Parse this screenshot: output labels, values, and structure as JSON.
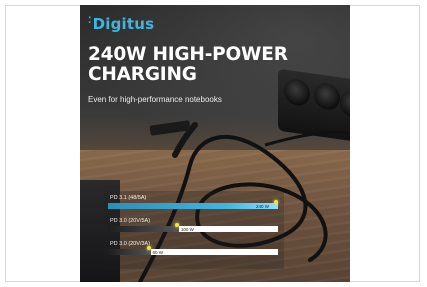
{
  "brand": {
    "name": "Digitus"
  },
  "headline": {
    "line1": "240W HIGH-POWER",
    "line2": "CHARGING"
  },
  "subline": "Even for high-performance notebooks",
  "chart_data": {
    "type": "bar",
    "orientation": "horizontal",
    "categories": [
      "PD 3.1 (48/5A)",
      "PD 3.0 (20V/5A)",
      "PD 3.0 (20V/3A)"
    ],
    "values": [
      240,
      100,
      60
    ],
    "value_labels": [
      "240 W",
      "100 W",
      "60 W"
    ],
    "xlim": [
      0,
      240
    ],
    "grid": false,
    "colors": {
      "primary": "#3fb6e0",
      "secondary": "#555555",
      "track": "#ffffff",
      "spark": "#e9e93a"
    }
  }
}
